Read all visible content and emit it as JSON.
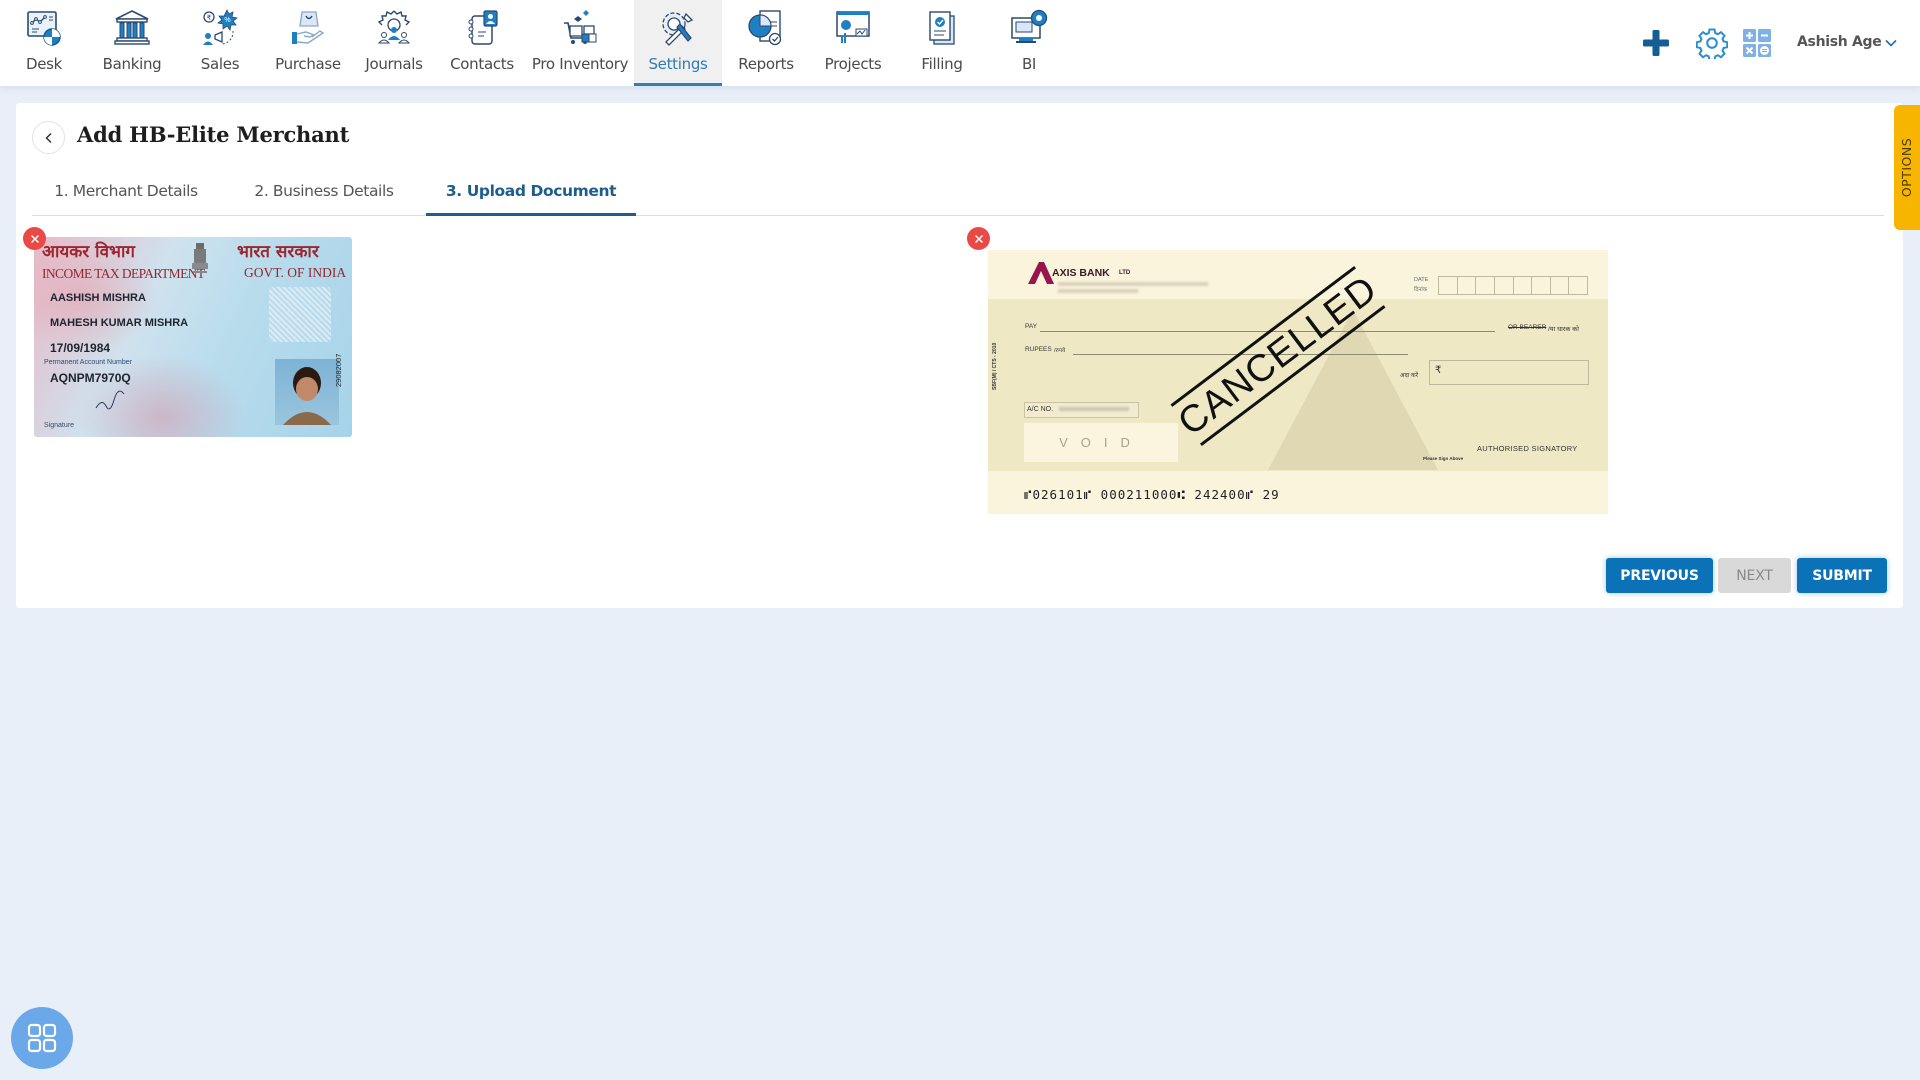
{
  "nav": {
    "items": [
      {
        "label": "Desk",
        "icon": "desk-icon",
        "active": false
      },
      {
        "label": "Banking",
        "icon": "bank-icon",
        "active": false
      },
      {
        "label": "Sales",
        "icon": "sales-icon",
        "active": false
      },
      {
        "label": "Purchase",
        "icon": "purchase-icon",
        "active": false
      },
      {
        "label": "Journals",
        "icon": "journals-icon",
        "active": false
      },
      {
        "label": "Contacts",
        "icon": "contacts-icon",
        "active": false
      },
      {
        "label": "Pro Inventory",
        "icon": "inventory-icon",
        "active": false
      },
      {
        "label": "Settings",
        "icon": "settings-tools-icon",
        "active": true
      },
      {
        "label": "Reports",
        "icon": "reports-icon",
        "active": false
      },
      {
        "label": "Projects",
        "icon": "projects-icon",
        "active": false
      },
      {
        "label": "Filling",
        "icon": "filling-icon",
        "active": false
      },
      {
        "label": "BI",
        "icon": "bi-icon",
        "active": false
      }
    ]
  },
  "header_actions": {
    "add_icon": "plus-icon",
    "settings_icon": "gear-icon",
    "calculator_icon": "calculator-icon",
    "user_name": "Ashish Age",
    "user_menu_icon": "chevron-down-icon"
  },
  "colors": {
    "primary": "#0c72b7",
    "active_tab": "#1d5e8e",
    "remove": "#ea4a45",
    "options_tab": "#f7b500",
    "background": "#e9eff9"
  },
  "page": {
    "title": "Add HB-Elite Merchant",
    "back_icon": "chevron-left-icon",
    "tabs": [
      {
        "label": "1. Merchant Details",
        "active": false
      },
      {
        "label": "2. Business Details",
        "active": false
      },
      {
        "label": "3. Upload Document",
        "active": true
      }
    ]
  },
  "documents": {
    "pan_card": {
      "hindi_left": "आयकर विभाग",
      "hindi_right": "भारत सरकार",
      "dept": "INCOME TAX DEPARTMENT",
      "govt": "GOVT. OF INDIA",
      "name": "AASHISH MISHRA",
      "father_name": "MAHESH KUMAR MISHRA",
      "dob": "17/09/1984",
      "pan_label": "Permanent Account Number",
      "pan_number": "AQNPM7970Q",
      "signature_label": "Signature",
      "photo_date": "29082007",
      "remove_label": "×"
    },
    "cheque": {
      "bank_name": "AXIS BANK",
      "bank_suffix": "LTD",
      "date_label": "DATE",
      "date_label_hi": "दिनांक",
      "pay_label": "PAY",
      "bearer_label": "OR BEARER",
      "bearer_label_hi": "/या धारक को",
      "rupees_label": "RUPEES",
      "rupees_label_hi": "/रुपये",
      "amount_label_hi": "अदा करें",
      "rupee_symbol": "₹",
      "acno_label": "A/C NO.",
      "void_label": "VOID",
      "signatory_label": "AUTHORISED SIGNATORY",
      "sign_hint": "Please Sign Above",
      "side_code": "SBF(M) / CTS - 2010",
      "stamp": "CANCELLED",
      "micr": "⑈026101⑈ 000211000⑆ 242400⑈ 29",
      "remove_label": "×"
    }
  },
  "buttons": {
    "previous": "PREVIOUS",
    "next": "NEXT",
    "submit": "SUBMIT"
  },
  "side_tab": {
    "label": "OPTIONS"
  },
  "fab": {
    "icon": "grid-apps-icon"
  }
}
